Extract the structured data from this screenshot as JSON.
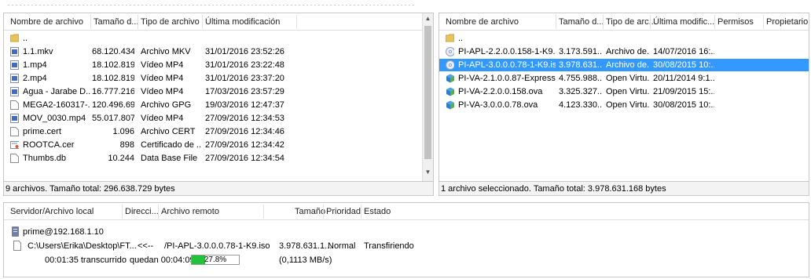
{
  "colors": {
    "selection": "#3399ff",
    "progress_fill": "#22c33a"
  },
  "local": {
    "columns": [
      "Nombre de archivo",
      "Tamaño d...",
      "Tipo de archivo",
      "Última modificación"
    ],
    "parent": "..",
    "rows": [
      {
        "name": "1.1.mkv",
        "size": "68.120.434",
        "type": "Archivo MKV",
        "modified": "31/01/2016 23:52:26",
        "icon": "video-file-icon"
      },
      {
        "name": "1.mp4",
        "size": "18.102.819",
        "type": "Vídeo MP4",
        "modified": "31/01/2016 23:22:48",
        "icon": "mp4-file-icon"
      },
      {
        "name": "2.mp4",
        "size": "18.102.819",
        "type": "Vídeo MP4",
        "modified": "31/01/2016 23:37:20",
        "icon": "mp4-file-icon"
      },
      {
        "name": "Agua - Jarabe D...",
        "size": "16.777.216",
        "type": "Vídeo MP4",
        "modified": "17/03/2016 23:57:29",
        "icon": "mp4-file-icon"
      },
      {
        "name": "MEGA2-160317-...",
        "size": "120.496.696",
        "type": "Archivo GPG",
        "modified": "19/03/2016 12:47:37",
        "icon": "generic-file-icon"
      },
      {
        "name": "MOV_0030.mp4",
        "size": "55.017.807",
        "type": "Vídeo MP4",
        "modified": "27/09/2016 12:34:53",
        "icon": "mp4-file-icon"
      },
      {
        "name": "prime.cert",
        "size": "1.096",
        "type": "Archivo CERT",
        "modified": "27/09/2016 12:34:46",
        "icon": "generic-file-icon"
      },
      {
        "name": "ROOTCA.cer",
        "size": "898",
        "type": "Certificado de ...",
        "modified": "27/09/2016 12:34:42",
        "icon": "certificate-file-icon"
      },
      {
        "name": "Thumbs.db",
        "size": "10.244",
        "type": "Data Base File",
        "modified": "27/09/2016 12:34:54",
        "icon": "generic-file-icon"
      }
    ],
    "status": "9 archivos. Tamaño total: 296.638.729 bytes"
  },
  "remote": {
    "columns": [
      "Nombre de archivo",
      "Tamaño d...",
      "Tipo de arc...",
      "Última modific...",
      "Permisos",
      "Propietario..."
    ],
    "parent": "..",
    "rows": [
      {
        "name": "PI-APL-2.2.0.0.158-1-K9.iso",
        "size": "3.173.591...",
        "type": "Archivo de...",
        "modified": "14/07/2016 16:...",
        "icon": "iso-file-icon",
        "selected": false
      },
      {
        "name": "PI-APL-3.0.0.0.78-1-K9.iso",
        "size": "3.978.631...",
        "type": "Archivo de...",
        "modified": "30/08/2015 10:...",
        "icon": "iso-file-icon",
        "selected": true
      },
      {
        "name": "PI-VA-2.1.0.0.87-Express.ova",
        "size": "4.755.988...",
        "type": "Open Virtu...",
        "modified": "20/11/2014 9:1...",
        "icon": "ova-file-icon",
        "selected": false
      },
      {
        "name": "PI-VA-2.2.0.0.158.ova",
        "size": "3.325.327...",
        "type": "Open Virtu...",
        "modified": "21/09/2015 15:...",
        "icon": "ova-file-icon",
        "selected": false
      },
      {
        "name": "PI-VA-3.0.0.0.78.ova",
        "size": "4.123.330...",
        "type": "Open Virtu...",
        "modified": "30/08/2015 10:...",
        "icon": "ova-file-icon",
        "selected": false
      }
    ],
    "status": "1 archivo seleccionado. Tamaño total: 3.978.631.168 bytes"
  },
  "queue": {
    "columns": [
      "Servidor/Archivo local",
      "Direcci...",
      "Archivo remoto",
      "Tamaño",
      "Prioridad",
      "Estado"
    ],
    "server": "prime@192.168.1.10",
    "item": {
      "local": "C:\\Users\\Erika\\Desktop\\FT...",
      "direction": "<<--",
      "remote": "/PI-APL-3.0.0.0.78-1-K9.iso",
      "size": "3.978.631.1...",
      "priority": "Normal",
      "state": "Transfiriendo"
    },
    "elapsed": "00:01:35 transcurrido",
    "remaining": "quedan 00:04:09",
    "progress_label": "27.8%",
    "progress_value": 27.8,
    "speed": "(0,1113 MB/s)"
  }
}
